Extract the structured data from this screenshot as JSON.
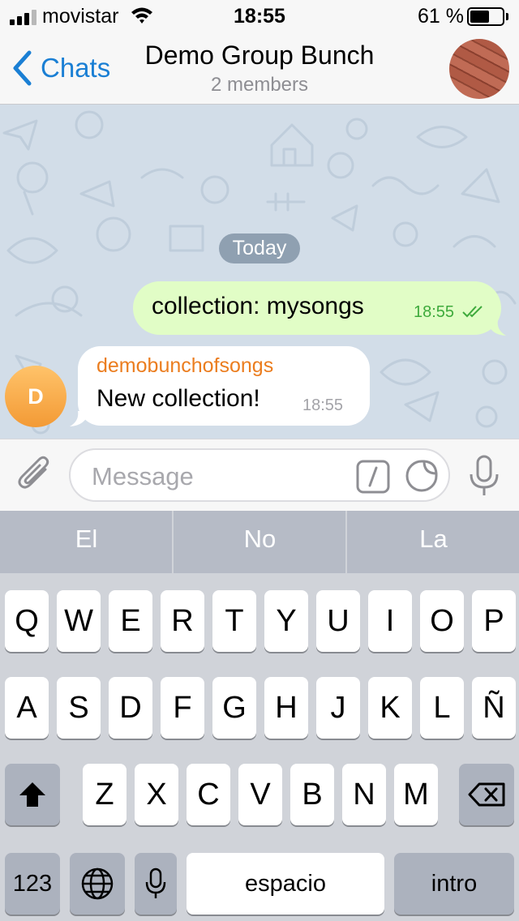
{
  "status_bar": {
    "carrier": "movistar",
    "time": "18:55",
    "battery_text": "61 %",
    "battery_level": 0.61
  },
  "nav": {
    "back_label": "Chats",
    "title": "Demo Group Bunch",
    "subtitle": "2 members"
  },
  "chat": {
    "date_label": "Today",
    "messages": [
      {
        "direction": "outgoing",
        "text": "collection: mysongs",
        "time": "18:55",
        "status": "read"
      },
      {
        "direction": "incoming",
        "sender": "demobunchofsongs",
        "sender_initial": "D",
        "text": "New collection!",
        "time": "18:55"
      }
    ]
  },
  "input": {
    "placeholder": "Message"
  },
  "keyboard": {
    "suggestions": [
      "El",
      "No",
      "La"
    ],
    "row1": [
      "Q",
      "W",
      "E",
      "R",
      "T",
      "Y",
      "U",
      "I",
      "O",
      "P"
    ],
    "row2": [
      "A",
      "S",
      "D",
      "F",
      "G",
      "H",
      "J",
      "K",
      "L",
      "Ñ"
    ],
    "row3": [
      "Z",
      "X",
      "C",
      "V",
      "B",
      "N",
      "M"
    ],
    "numbers_label": "123",
    "space_label": "espacio",
    "return_label": "intro"
  },
  "colors": {
    "accent": "#1a7fd4",
    "outgoing_bubble": "#e1fdc6",
    "read_check": "#3eaa3c",
    "sender_name": "#eb7d1f",
    "chat_background": "#d2dde8"
  }
}
